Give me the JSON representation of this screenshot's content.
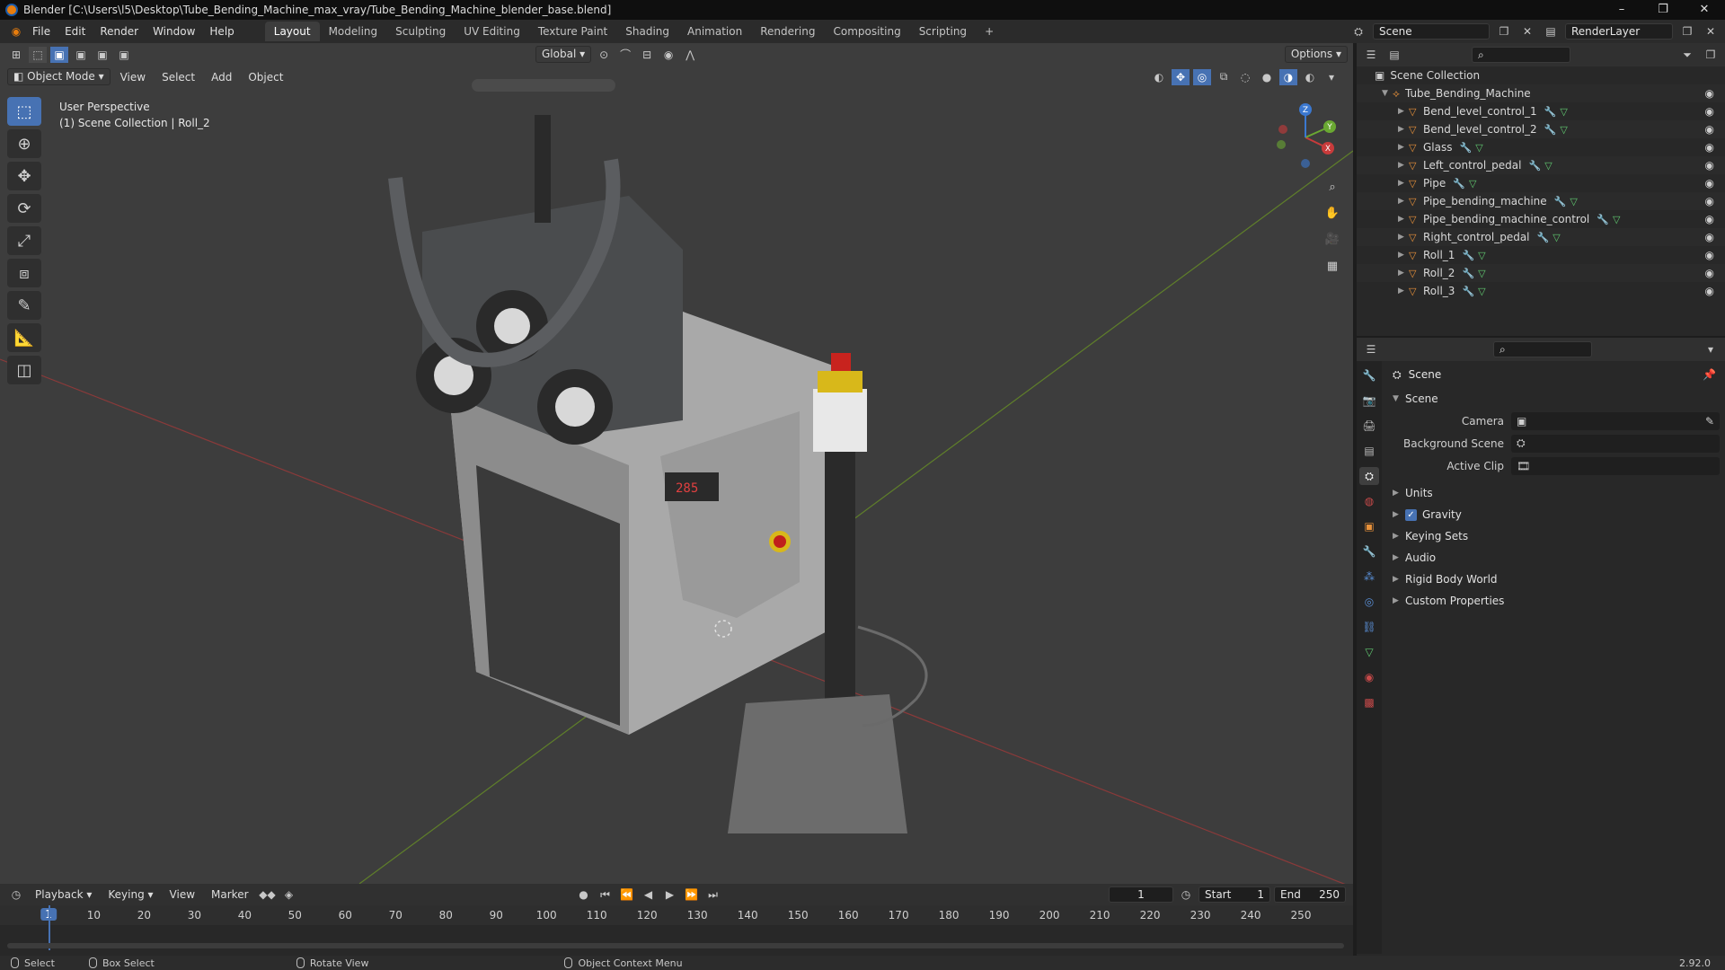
{
  "window": {
    "title": "Blender [C:\\Users\\l5\\Desktop\\Tube_Bending_Machine_max_vray/Tube_Bending_Machine_blender_base.blend]",
    "minimize": "–",
    "maximize": "❐",
    "close": "✕"
  },
  "menus": [
    "File",
    "Edit",
    "Render",
    "Window",
    "Help"
  ],
  "workspaces": [
    "Layout",
    "Modeling",
    "Sculpting",
    "UV Editing",
    "Texture Paint",
    "Shading",
    "Animation",
    "Rendering",
    "Compositing",
    "Scripting"
  ],
  "active_workspace": "Layout",
  "add_workspace": "+",
  "scene_field": "Scene",
  "view_layer_field": "RenderLayer",
  "viewport": {
    "mode": "Object Mode",
    "menus": [
      "View",
      "Select",
      "Add",
      "Object"
    ],
    "transform_orientation": "Global",
    "options": "Options",
    "info_line1": "User Perspective",
    "info_line2": "(1) Scene Collection | Roll_2",
    "display": "285",
    "gizmo_labels": {
      "x": "X",
      "y": "Y",
      "z": "Z"
    }
  },
  "outliner": {
    "root": "Scene Collection",
    "collection": "Tube_Bending_Machine",
    "items": [
      "Bend_level_control_1",
      "Bend_level_control_2",
      "Glass",
      "Left_control_pedal",
      "Pipe",
      "Pipe_bending_machine",
      "Pipe_bending_machine_control",
      "Right_control_pedal",
      "Roll_1",
      "Roll_2",
      "Roll_3"
    ]
  },
  "properties": {
    "title": "Scene",
    "panel": "Scene",
    "fields": [
      {
        "label": "Camera",
        "value": ""
      },
      {
        "label": "Background Scene",
        "value": ""
      },
      {
        "label": "Active Clip",
        "value": ""
      }
    ],
    "subpanels": [
      "Units",
      "Gravity",
      "Keying Sets",
      "Audio",
      "Rigid Body World",
      "Custom Properties"
    ],
    "gravity_checked": true
  },
  "timeline": {
    "menus": [
      "Playback",
      "Keying",
      "View",
      "Marker"
    ],
    "current_frame": "1",
    "start_label": "Start",
    "start": "1",
    "end_label": "End",
    "end": "250",
    "ticks": [
      "1",
      "10",
      "20",
      "30",
      "40",
      "50",
      "60",
      "70",
      "80",
      "90",
      "100",
      "110",
      "120",
      "130",
      "140",
      "150",
      "160",
      "170",
      "180",
      "190",
      "200",
      "210",
      "220",
      "230",
      "240",
      "250"
    ]
  },
  "statusbar": {
    "select": "Select",
    "box_select": "Box Select",
    "rotate_view": "Rotate View",
    "context_menu": "Object Context Menu",
    "version": "2.92.0"
  },
  "colors": {
    "accent": "#4772b3",
    "object": "#e8913a",
    "modifier": "#5a8fd6",
    "mesh": "#60c870"
  }
}
